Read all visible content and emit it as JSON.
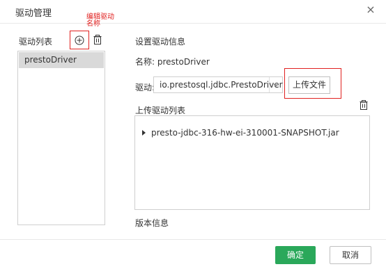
{
  "dialog": {
    "title": "驱动管理",
    "close_glyph": "×"
  },
  "left_panel": {
    "label": "驱动列表",
    "annotation": "编辑驱动名称",
    "drivers": [
      {
        "label": "prestoDriver",
        "selected": true
      }
    ]
  },
  "right_panel": {
    "section_title": "设置驱动信息",
    "name_label": "名称:",
    "name_value": "prestoDriver",
    "driver_label": "驱动:",
    "driver_value": "io.prestosql.jdbc.PrestoDriver",
    "upload_button": "上传文件",
    "uploaded_list_label": "上传驱动列表",
    "files": [
      {
        "label": "presto-jdbc-316-hw-ei-310001-SNAPSHOT.jar"
      }
    ],
    "version_label": "版本信息"
  },
  "footer": {
    "ok_label": "确定",
    "cancel_label": "取消"
  },
  "colors": {
    "primary": "#2aa85a",
    "annotation": "#e0201f",
    "selected_row": "#d9d9d9"
  },
  "icons": {
    "add": "add-circle-icon",
    "delete": "trash-icon",
    "dropdown": "chevron-down-icon",
    "close": "close-icon",
    "expand": "caret-right-icon"
  }
}
